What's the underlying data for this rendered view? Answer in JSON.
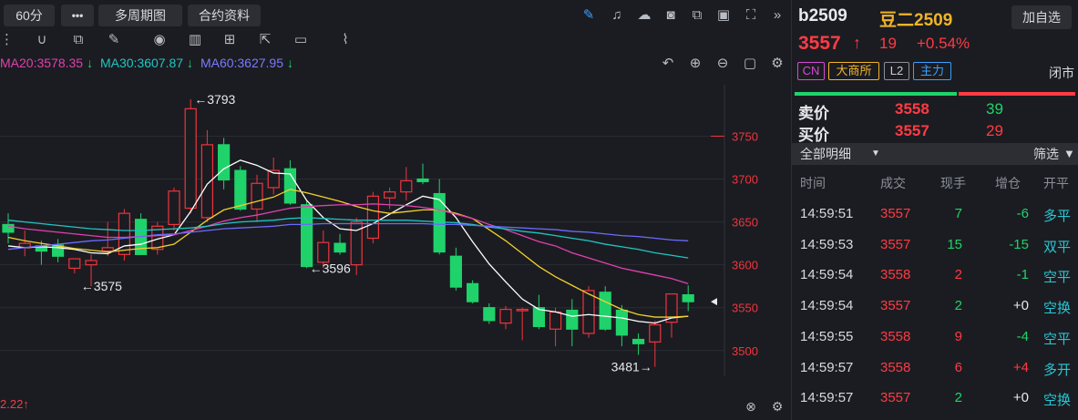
{
  "toolbar": {
    "period": "60分",
    "more": "•••",
    "multi_period": "多周期图",
    "contract_info": "合约资料"
  },
  "ma": {
    "ma20": "MA20:3578.35",
    "ma30": "MA30:3607.87",
    "ma60": "MA60:3627.95",
    "colors": {
      "ma5": "#ffffff",
      "ma10": "#f0d12c",
      "ma20": "#e040b0",
      "ma30": "#20c5c5",
      "ma60": "#6b6bff",
      "up": "#f0343e",
      "down": "#1fd36a"
    }
  },
  "indicator_value": "2.22",
  "chart_data": {
    "type": "candlestick",
    "ylim": [
      3470,
      3810
    ],
    "y_ticks": [
      "3750",
      "3700",
      "3650",
      "3600",
      "3550",
      "3500"
    ],
    "annotations": [
      "←3793",
      "←3575",
      "←3596",
      "3481→"
    ],
    "candles": [
      {
        "o": 3647,
        "h": 3660,
        "l": 3625,
        "c": 3638
      },
      {
        "o": 3620,
        "h": 3640,
        "l": 3610,
        "c": 3625
      },
      {
        "o": 3622,
        "h": 3628,
        "l": 3600,
        "c": 3616
      },
      {
        "o": 3623,
        "h": 3630,
        "l": 3603,
        "c": 3610
      },
      {
        "o": 3596,
        "h": 3602,
        "l": 3590,
        "c": 3607
      },
      {
        "o": 3600,
        "h": 3612,
        "l": 3575,
        "c": 3605
      },
      {
        "o": 3616,
        "h": 3650,
        "l": 3610,
        "c": 3620
      },
      {
        "o": 3612,
        "h": 3665,
        "l": 3605,
        "c": 3660
      },
      {
        "o": 3653,
        "h": 3660,
        "l": 3612,
        "c": 3612
      },
      {
        "o": 3618,
        "h": 3650,
        "l": 3612,
        "c": 3645
      },
      {
        "o": 3647,
        "h": 3690,
        "l": 3640,
        "c": 3686
      },
      {
        "o": 3666,
        "h": 3793,
        "l": 3660,
        "c": 3782
      },
      {
        "o": 3655,
        "h": 3757,
        "l": 3650,
        "c": 3740
      },
      {
        "o": 3740,
        "h": 3748,
        "l": 3688,
        "c": 3699
      },
      {
        "o": 3710,
        "h": 3715,
        "l": 3663,
        "c": 3665
      },
      {
        "o": 3665,
        "h": 3705,
        "l": 3650,
        "c": 3695
      },
      {
        "o": 3690,
        "h": 3725,
        "l": 3682,
        "c": 3710
      },
      {
        "o": 3712,
        "h": 3722,
        "l": 3670,
        "c": 3672
      },
      {
        "o": 3670,
        "h": 3675,
        "l": 3596,
        "c": 3598
      },
      {
        "o": 3603,
        "h": 3640,
        "l": 3596,
        "c": 3626
      },
      {
        "o": 3625,
        "h": 3636,
        "l": 3612,
        "c": 3615
      },
      {
        "o": 3600,
        "h": 3655,
        "l": 3588,
        "c": 3650
      },
      {
        "o": 3631,
        "h": 3685,
        "l": 3625,
        "c": 3680
      },
      {
        "o": 3678,
        "h": 3690,
        "l": 3665,
        "c": 3685
      },
      {
        "o": 3685,
        "h": 3714,
        "l": 3675,
        "c": 3698
      },
      {
        "o": 3700,
        "h": 3718,
        "l": 3694,
        "c": 3697
      },
      {
        "o": 3683,
        "h": 3700,
        "l": 3612,
        "c": 3615
      },
      {
        "o": 3610,
        "h": 3620,
        "l": 3570,
        "c": 3574
      },
      {
        "o": 3578,
        "h": 3582,
        "l": 3555,
        "c": 3557
      },
      {
        "o": 3550,
        "h": 3555,
        "l": 3531,
        "c": 3535
      },
      {
        "o": 3532,
        "h": 3552,
        "l": 3525,
        "c": 3548
      },
      {
        "o": 3548,
        "h": 3550,
        "l": 3512,
        "c": 3548
      },
      {
        "o": 3550,
        "h": 3565,
        "l": 3525,
        "c": 3528
      },
      {
        "o": 3525,
        "h": 3550,
        "l": 3505,
        "c": 3545
      },
      {
        "o": 3547,
        "h": 3560,
        "l": 3505,
        "c": 3525
      },
      {
        "o": 3520,
        "h": 3575,
        "l": 3515,
        "c": 3570
      },
      {
        "o": 3568,
        "h": 3575,
        "l": 3523,
        "c": 3525
      },
      {
        "o": 3547,
        "h": 3553,
        "l": 3505,
        "c": 3518
      },
      {
        "o": 3513,
        "h": 3520,
        "l": 3495,
        "c": 3508
      },
      {
        "o": 3510,
        "h": 3535,
        "l": 3481,
        "c": 3530
      },
      {
        "o": 3533,
        "h": 3566,
        "l": 3515,
        "c": 3566
      },
      {
        "o": 3565,
        "h": 3576,
        "l": 3546,
        "c": 3557
      }
    ],
    "series": [
      {
        "name": "MA5",
        "values": [
          3622,
          3620,
          3621,
          3620,
          3618,
          3614,
          3613,
          3622,
          3624,
          3630,
          3635,
          3662,
          3694,
          3712,
          3722,
          3716,
          3707,
          3706,
          3675,
          3655,
          3642,
          3640,
          3648,
          3659,
          3670,
          3680,
          3676,
          3655,
          3627,
          3601,
          3580,
          3560,
          3548,
          3545,
          3540,
          3542,
          3540,
          3538,
          3534,
          3532,
          3538,
          3540
        ]
      },
      {
        "name": "MA10",
        "values": [
          3632,
          3628,
          3625,
          3622,
          3619,
          3617,
          3615,
          3617,
          3619,
          3620,
          3624,
          3638,
          3652,
          3664,
          3669,
          3674,
          3679,
          3688,
          3684,
          3679,
          3674,
          3668,
          3663,
          3660,
          3662,
          3664,
          3664,
          3660,
          3654,
          3641,
          3628,
          3613,
          3598,
          3586,
          3576,
          3566,
          3557,
          3548,
          3542,
          3539,
          3539,
          3540
        ]
      },
      {
        "name": "MA20",
        "values": [
          3645,
          3642,
          3640,
          3638,
          3636,
          3634,
          3632,
          3632,
          3633,
          3634,
          3635,
          3640,
          3645,
          3651,
          3655,
          3658,
          3662,
          3666,
          3668,
          3669,
          3670,
          3670,
          3671,
          3670,
          3669,
          3667,
          3664,
          3659,
          3654,
          3647,
          3641,
          3634,
          3627,
          3622,
          3614,
          3608,
          3602,
          3596,
          3592,
          3588,
          3584,
          3578
        ]
      },
      {
        "name": "MA30",
        "values": [
          3652,
          3650,
          3648,
          3646,
          3644,
          3642,
          3641,
          3640,
          3640,
          3641,
          3642,
          3643,
          3645,
          3648,
          3650,
          3651,
          3652,
          3654,
          3655,
          3654,
          3653,
          3652,
          3652,
          3652,
          3652,
          3651,
          3650,
          3649,
          3647,
          3644,
          3642,
          3639,
          3637,
          3634,
          3631,
          3628,
          3624,
          3621,
          3618,
          3614,
          3611,
          3608
        ]
      },
      {
        "name": "MA60",
        "values": [
          3618,
          3620,
          3622,
          3624,
          3626,
          3628,
          3629,
          3631,
          3633,
          3635,
          3636,
          3638,
          3640,
          3642,
          3643,
          3644,
          3645,
          3647,
          3647,
          3648,
          3648,
          3648,
          3648,
          3648,
          3648,
          3648,
          3647,
          3647,
          3646,
          3645,
          3644,
          3643,
          3642,
          3641,
          3639,
          3638,
          3636,
          3634,
          3633,
          3631,
          3629,
          3628
        ]
      }
    ]
  },
  "symbol": {
    "code": "b2509",
    "name": "豆二2509",
    "add_watch": "加自选",
    "price": "3557",
    "change": "19",
    "change_pct": "+0.54%",
    "tags": [
      "CN",
      "大商所",
      "L2",
      "主力"
    ],
    "status": "闭市"
  },
  "orderbook": {
    "ask_label": "卖价",
    "ask_price": "3558",
    "ask_vol": "39",
    "bid_label": "买价",
    "bid_price": "3557",
    "bid_vol": "29"
  },
  "details": {
    "title": "全部明细",
    "filter": "筛选",
    "headers": [
      "时间",
      "成交",
      "现手",
      "增仓",
      "开平"
    ],
    "rows": [
      {
        "time": "14:59:51",
        "price": "3557",
        "vol": "7",
        "oi": "-6",
        "type": "多平",
        "vol_color": "#1fd36a",
        "oi_color": "#1fd36a",
        "type_color": "#28c7d4"
      },
      {
        "time": "14:59:53",
        "price": "3557",
        "vol": "15",
        "oi": "-15",
        "type": "双平",
        "vol_color": "#1fd36a",
        "oi_color": "#1fd36a",
        "type_color": "#28c7d4"
      },
      {
        "time": "14:59:54",
        "price": "3558",
        "vol": "2",
        "oi": "-1",
        "type": "空平",
        "vol_color": "#ff3b44",
        "oi_color": "#1fd36a",
        "type_color": "#28c7d4"
      },
      {
        "time": "14:59:54",
        "price": "3557",
        "vol": "2",
        "oi": "+0",
        "type": "空换",
        "vol_color": "#1fd36a",
        "oi_color": "#e7e9ec",
        "type_color": "#28c7d4"
      },
      {
        "time": "14:59:55",
        "price": "3558",
        "vol": "9",
        "oi": "-4",
        "type": "空平",
        "vol_color": "#ff3b44",
        "oi_color": "#1fd36a",
        "type_color": "#28c7d4"
      },
      {
        "time": "14:59:57",
        "price": "3558",
        "vol": "6",
        "oi": "+4",
        "type": "多开",
        "vol_color": "#ff3b44",
        "oi_color": "#ff3b44",
        "type_color": "#28c7d4"
      },
      {
        "time": "14:59:57",
        "price": "3557",
        "vol": "2",
        "oi": "+0",
        "type": "空换",
        "vol_color": "#1fd36a",
        "oi_color": "#e7e9ec",
        "type_color": "#28c7d4"
      }
    ]
  }
}
